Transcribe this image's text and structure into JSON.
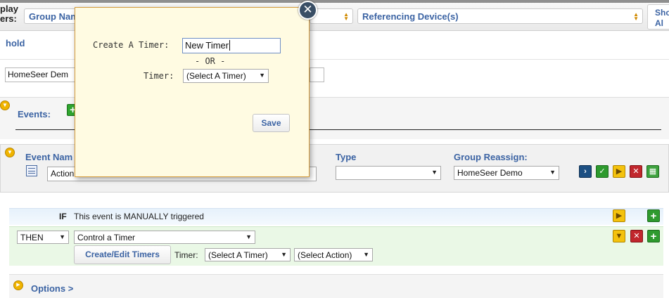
{
  "topbar": {
    "display_filters_label_line1": "play",
    "display_filters_label_line2": "ers:",
    "group_name_select": "Group Nam",
    "middle_select": "",
    "referencing_device_select": "Referencing Device(s)",
    "show_all_line1": "Sho",
    "show_all_line2": "Al"
  },
  "group": {
    "header_text": "hold",
    "name_value": "HomeSeer Dem"
  },
  "events": {
    "label": "Events:",
    "add_icon": "plus-icon"
  },
  "event_row": {
    "event_name_label": "Event Nam",
    "event_name_value": "Action",
    "type_label": "Type",
    "type_value": "",
    "group_reassign_label": "Group Reassign:",
    "group_reassign_value": "HomeSeer Demo",
    "action_icons": [
      "run-icon",
      "check-icon",
      "play-icon",
      "delete-icon",
      "calendar-icon"
    ]
  },
  "if_row": {
    "keyword": "IF",
    "text": "This event is MANUALLY triggered"
  },
  "then_row": {
    "keyword_select": "THEN",
    "action_select": "Control a Timer",
    "create_edit_button": "Create/Edit Timers",
    "timer_label": "Timer:",
    "timer_select": "(Select A Timer)",
    "action_type_select": "(Select Action)"
  },
  "options": {
    "label": "Options >"
  },
  "modal": {
    "create_label": "Create A Timer:",
    "create_value": "New Timer",
    "or_text": "- OR -",
    "timer_label": "Timer:",
    "timer_select": "(Select A Timer)",
    "save_button": "Save",
    "close_icon": "close-icon"
  },
  "colors": {
    "accent_blue": "#3b63a3",
    "modal_background": "#fffbe2",
    "modal_border": "#d59b3a",
    "then_row_background": "#eaf8e6",
    "if_row_background": "#e6f1fb"
  }
}
